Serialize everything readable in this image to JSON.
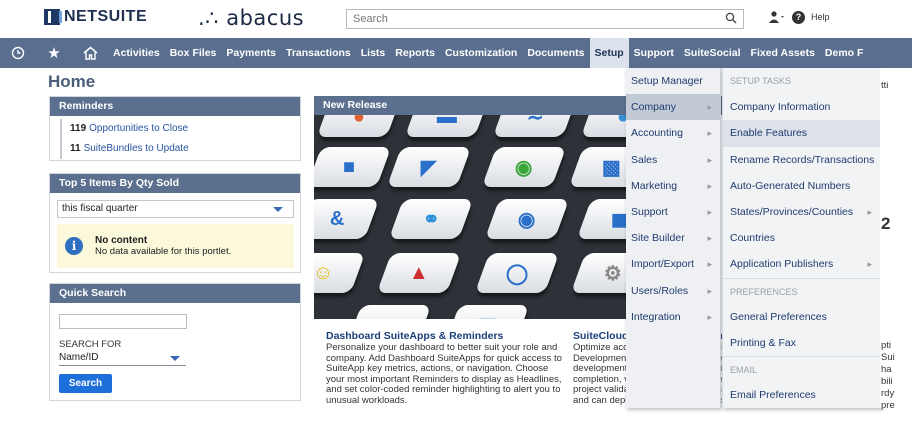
{
  "header": {
    "brand": "NETSUITE",
    "partner_logo": ".∴ abacus",
    "search_placeholder": "Search",
    "help_label": "Help"
  },
  "nav": {
    "items": [
      "Activities",
      "Box Files",
      "Payments",
      "Transactions",
      "Lists",
      "Reports",
      "Customization",
      "Documents",
      "Setup",
      "Support",
      "SuiteSocial",
      "Fixed Assets",
      "Demo F"
    ],
    "active": "Setup"
  },
  "page": {
    "title": "Home"
  },
  "reminders": {
    "title": "Reminders",
    "items": [
      {
        "count": "119",
        "label": "Opportunities to Close"
      },
      {
        "count": "11",
        "label": "SuiteBundles to Update"
      }
    ]
  },
  "top5": {
    "title": "Top 5 Items By Qty Sold",
    "period": "this fiscal quarter",
    "empty_title": "No content",
    "empty_text": "No data available for this portlet."
  },
  "quick_search": {
    "title": "Quick Search",
    "search_for_label": "SEARCH FOR",
    "search_for_value": "Name/ID",
    "button": "Search"
  },
  "new_release": {
    "title": "New Release",
    "article1_title": "Dashboard SuiteApps & Reminders",
    "article1_body": "Personalize your dashboard to better suit your role and company. Add Dashboard SuiteApps for quick access to SuiteApp key metrics, actions, or navigation. Choose your most important Reminders to display as Headlines, and set color-coded reminder highlighting to alert you to unusual workloads.",
    "article2_title": "SuiteCloud Development Frame",
    "article2_lines": [
      "Optimize account customization usin",
      "Development Framework. Facilitate t",
      "development with IDE integration, ric",
      "completion, version control, change i",
      "project validation. SDF handles miss",
      "and can deploy to test environments"
    ]
  },
  "setup_menu": {
    "items": [
      {
        "label": "Setup Manager",
        "submenu": false
      },
      {
        "label": "Company",
        "submenu": true
      },
      {
        "label": "Accounting",
        "submenu": true
      },
      {
        "label": "Sales",
        "submenu": true
      },
      {
        "label": "Marketing",
        "submenu": true
      },
      {
        "label": "Support",
        "submenu": true
      },
      {
        "label": "Site Builder",
        "submenu": true
      },
      {
        "label": "Import/Export",
        "submenu": true
      },
      {
        "label": "Users/Roles",
        "submenu": true
      },
      {
        "label": "Integration",
        "submenu": true
      }
    ],
    "highlighted": "Company"
  },
  "company_submenu": {
    "items": [
      {
        "label": "SETUP TASKS",
        "type": "section"
      },
      {
        "label": "Company Information",
        "type": "item"
      },
      {
        "label": "Enable Features",
        "type": "item",
        "highlighted": true
      },
      {
        "label": "Rename Records/Transactions",
        "type": "item"
      },
      {
        "label": "Auto-Generated Numbers",
        "type": "item"
      },
      {
        "label": "States/Provinces/Counties",
        "type": "item",
        "submenu": true
      },
      {
        "label": "Countries",
        "type": "item"
      },
      {
        "label": "Application Publishers",
        "type": "item",
        "submenu": true
      },
      {
        "label": "PREFERENCES",
        "type": "section"
      },
      {
        "label": "General Preferences",
        "type": "item"
      },
      {
        "label": "Printing & Fax",
        "type": "item"
      },
      {
        "label": "EMAIL",
        "type": "section"
      },
      {
        "label": "Email Preferences",
        "type": "item"
      }
    ]
  },
  "right_edge_fragments": [
    "tti",
    "2",
    "pti",
    "Sui",
    "ha",
    "bili",
    "rdy",
    "pre"
  ]
}
